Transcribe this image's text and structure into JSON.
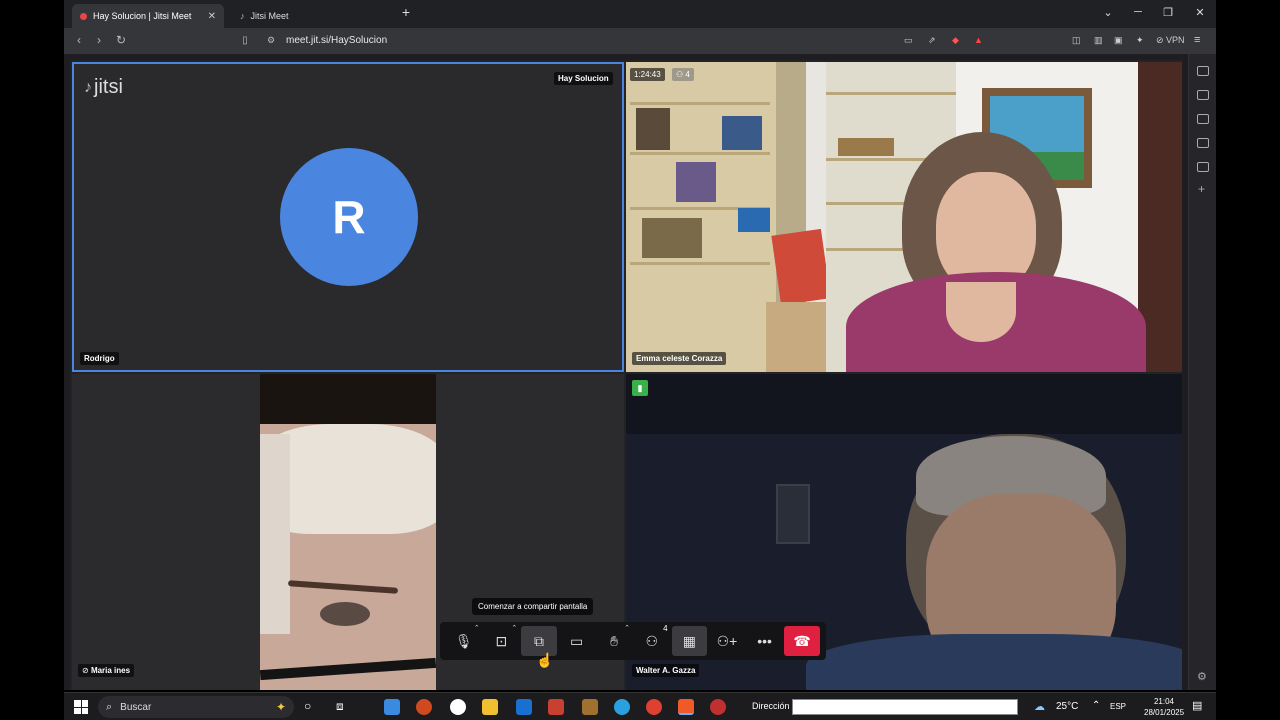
{
  "browser": {
    "tabs": [
      {
        "label": "Hay Solucion | Jitsi Meet",
        "active": true
      },
      {
        "label": "Jitsi Meet",
        "active": false
      }
    ],
    "url": "meet.jit.si/HaySolucion",
    "vpn_label": "VPN"
  },
  "meeting": {
    "logo": "jitsi",
    "room_name": "Hay Solucion",
    "timer": "1:24:43",
    "participants_count_small": "4"
  },
  "tiles": {
    "rodrigo": {
      "name": "Rodrigo",
      "avatar_letter": "R",
      "avatar_color": "#4a86e0"
    },
    "emma": {
      "name": "Emma celeste Corazza"
    },
    "maria": {
      "name": "Maria ines"
    },
    "walter": {
      "name": "Walter A. Gazza"
    }
  },
  "toolbar": {
    "tooltip": "Comenzar a compartir pantalla",
    "participants_badge": "4"
  },
  "taskbar": {
    "search_placeholder": "Buscar",
    "address_label": "Dirección",
    "temperature": "25°C",
    "language": "ESP",
    "time": "21:04",
    "date": "28/01/2025"
  },
  "colors": {
    "accent_border": "#4a86e0",
    "hangup": "#e02040"
  }
}
